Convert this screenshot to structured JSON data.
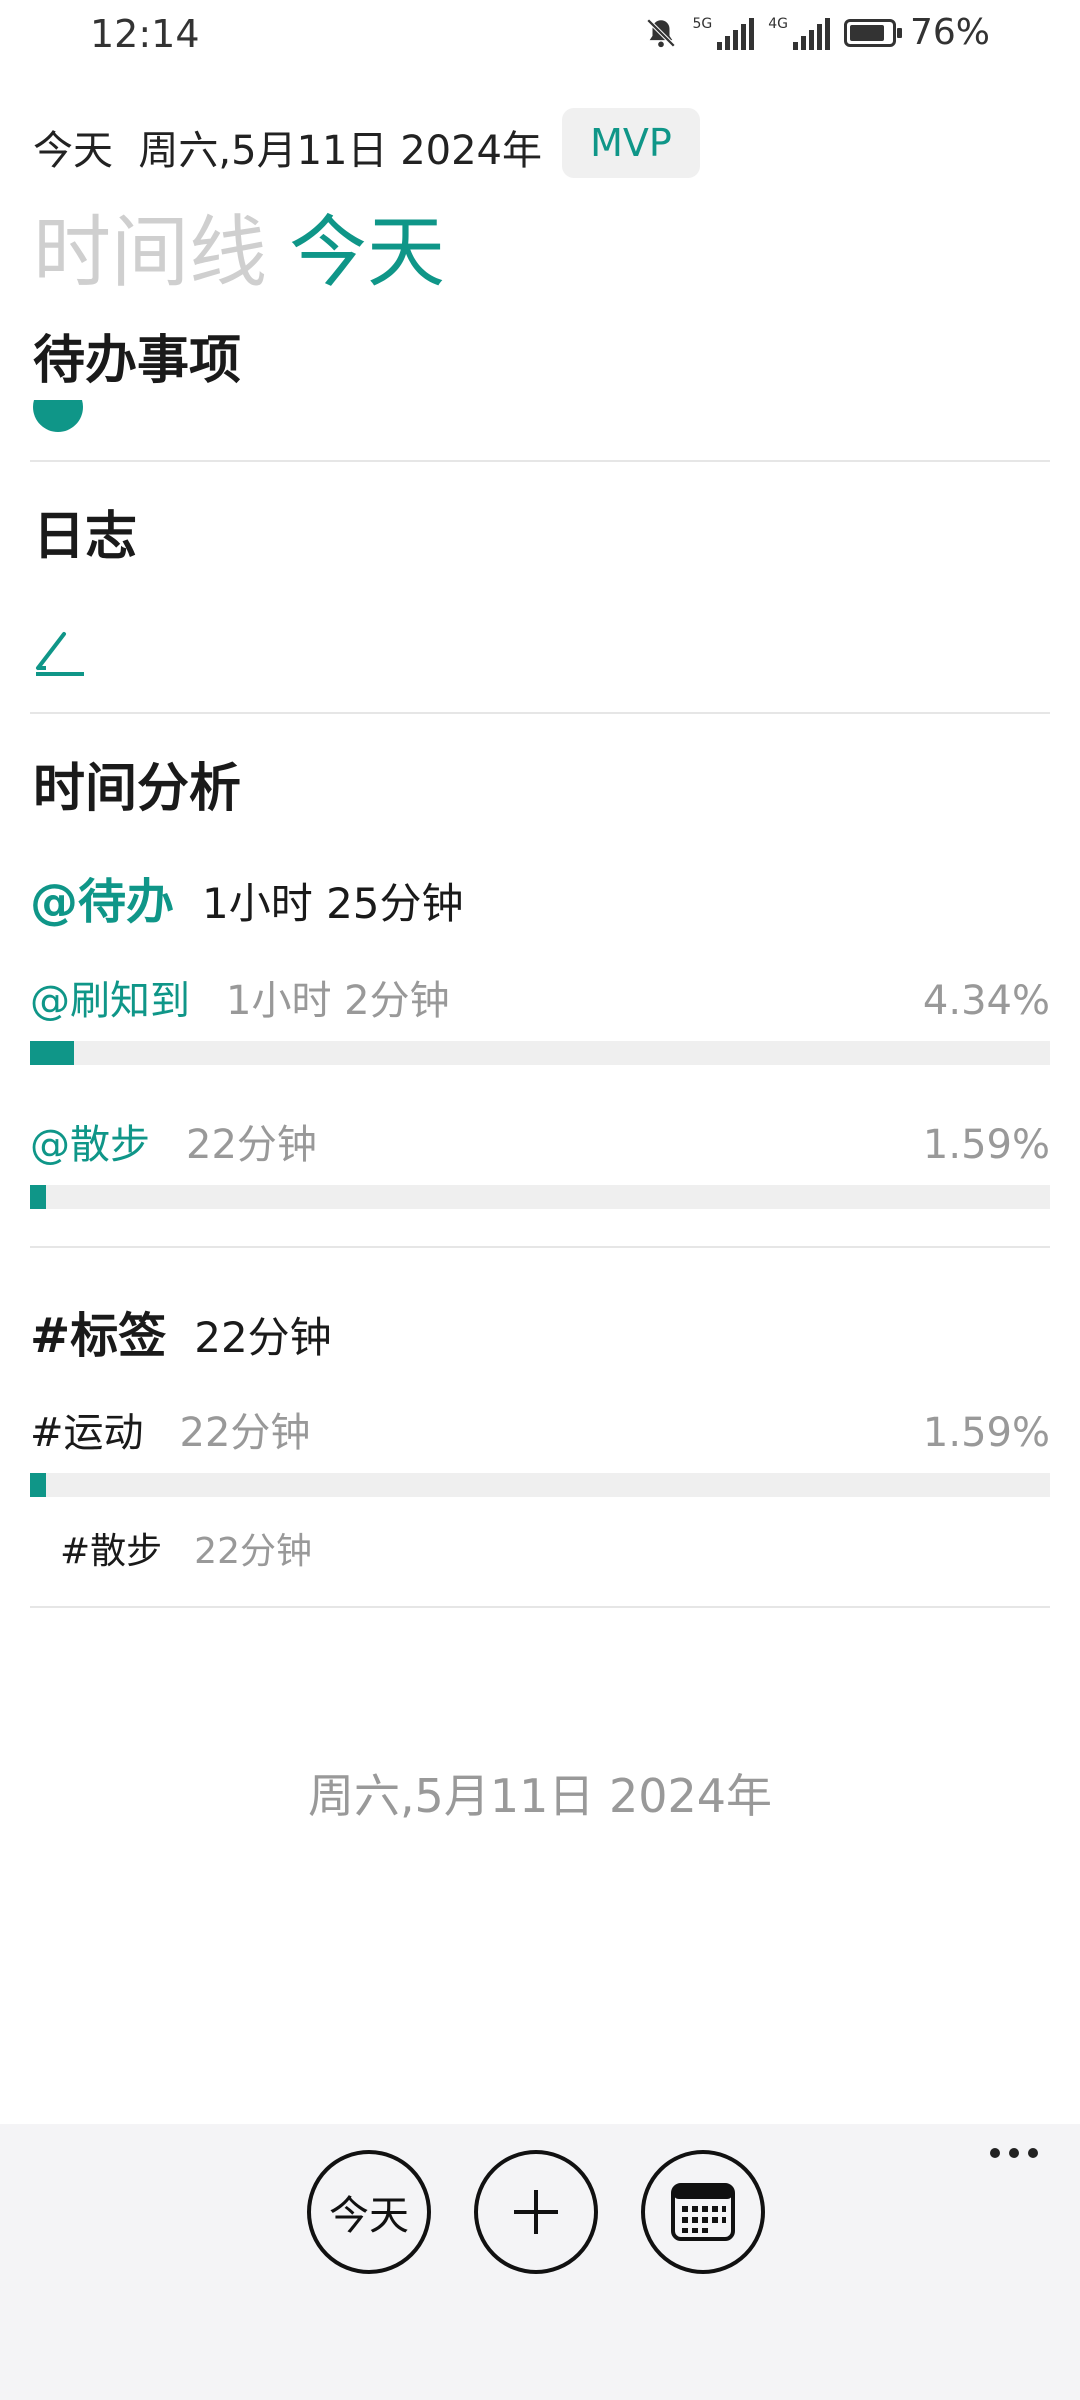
{
  "status_bar": {
    "time": "12:14",
    "network1": "5G",
    "network2": "4G",
    "battery": "76%",
    "icons": [
      "bell-muted-icon",
      "signal-5g-icon",
      "signal-4g-icon",
      "battery-icon"
    ]
  },
  "header": {
    "date_line": "今天  周六,5月11日 2024年",
    "badge": "MVP",
    "title_muted": "时间线",
    "title_active": "今天"
  },
  "sections": {
    "todo": "待办事项",
    "journal": "日志",
    "analysis": "时间分析"
  },
  "analysis": {
    "todo_group": {
      "name": "@待办",
      "duration": "1小时 25分钟",
      "items": [
        {
          "name": "@刷知到",
          "duration": "1小时 2分钟",
          "percent": "4.34%",
          "fraction": 0.0434
        },
        {
          "name": "@散步",
          "duration": "22分钟",
          "percent": "1.59%",
          "fraction": 0.0159
        }
      ]
    },
    "tag_group": {
      "name": "#标签",
      "duration": "22分钟",
      "items": [
        {
          "name": "#运动",
          "duration": "22分钟",
          "percent": "1.59%",
          "fraction": 0.0159
        }
      ],
      "sub_items": [
        {
          "name": "#散步",
          "duration": "22分钟"
        }
      ]
    }
  },
  "footer_date": "周六,5月11日 2024年",
  "bottom_bar": {
    "today_label": "今天",
    "add_label": "+",
    "calendar_icon": "calendar-icon",
    "more_icon": "more-icon"
  },
  "colors": {
    "accent": "#0f9688",
    "muted": "#cfcfcf",
    "bar_track": "#efefef"
  }
}
